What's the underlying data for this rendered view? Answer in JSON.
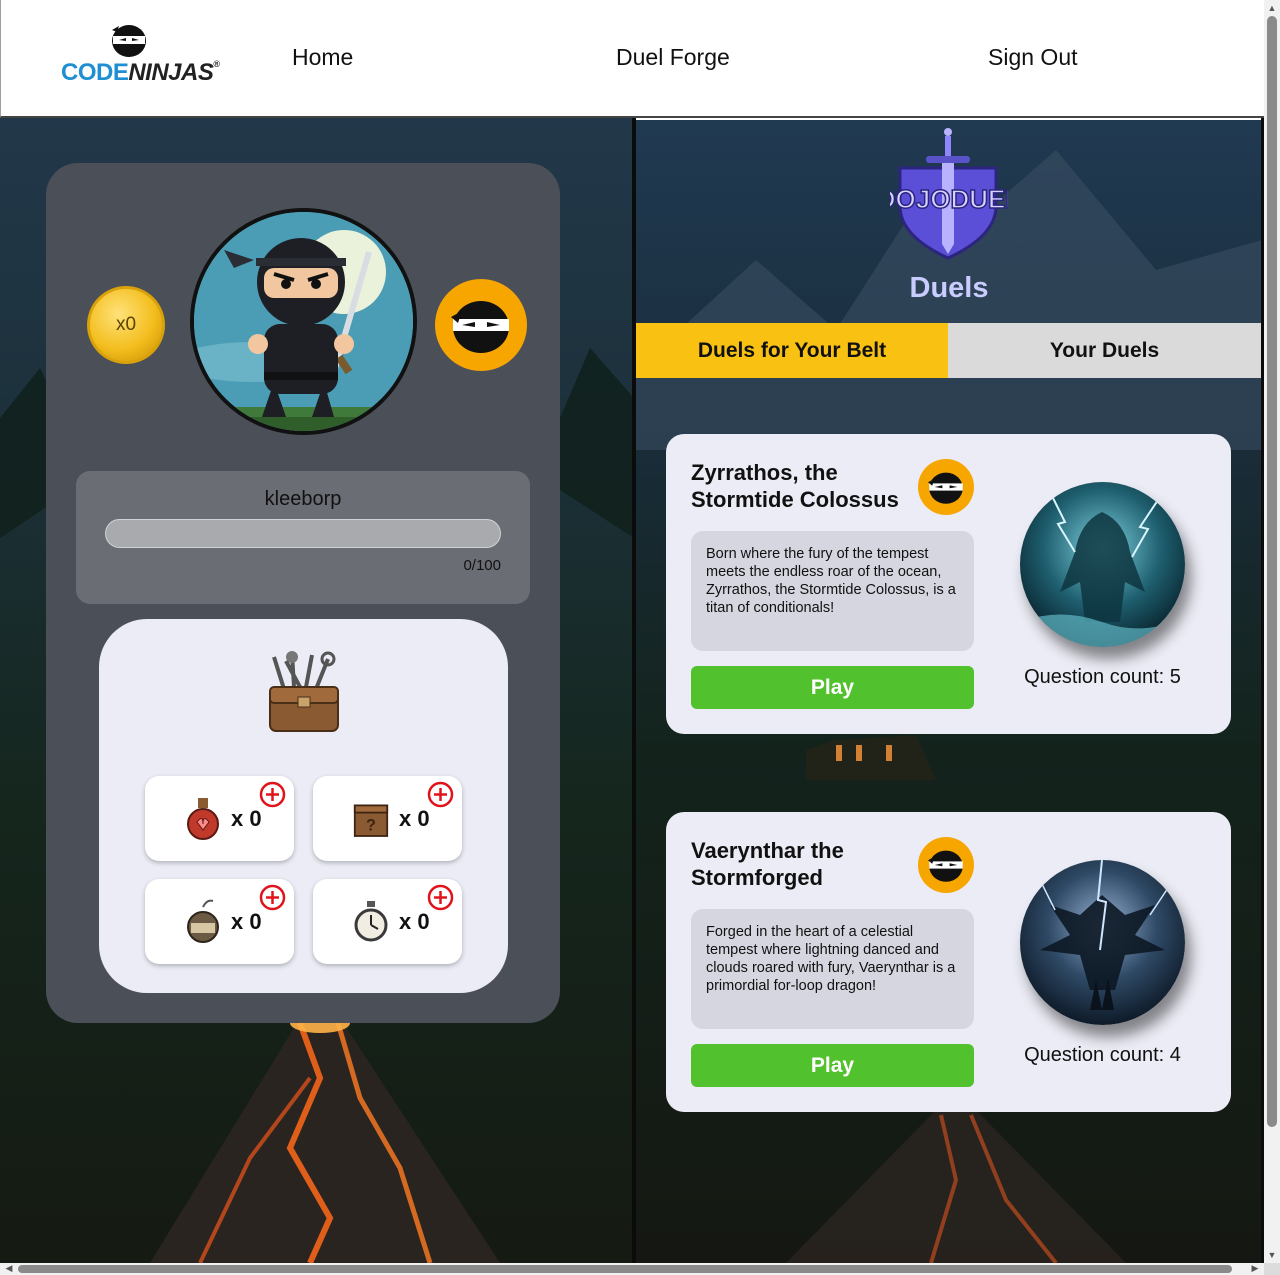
{
  "header": {
    "logo": {
      "part1": "CODE",
      "part2": "NINJAS",
      "reg": "®"
    },
    "nav": [
      {
        "label": "Home"
      },
      {
        "label": "Duel Forge"
      },
      {
        "label": "Sign Out"
      }
    ]
  },
  "profile": {
    "coins": "x0",
    "username": "kleeborp",
    "xp": {
      "current": 0,
      "max": 100,
      "label": "0/100"
    },
    "inventory": [
      {
        "icon": "health-potion-icon",
        "qty": "x 0"
      },
      {
        "icon": "mystery-box-icon",
        "qty": "x 0"
      },
      {
        "icon": "smoke-bomb-icon",
        "qty": "x 0",
        "icon_text": "SMOKE BOMB"
      },
      {
        "icon": "stopwatch-icon",
        "qty": "x 0"
      }
    ]
  },
  "dojo": {
    "logo_text": "DOJODUEL",
    "title": "Duels",
    "tabs": [
      {
        "label": "Duels for Your Belt",
        "active": true
      },
      {
        "label": "Your Duels",
        "active": false
      }
    ],
    "duels": [
      {
        "name": "Zyrrathos, the Stormtide Colossus",
        "description": "Born where the fury of the tempest meets the endless roar of the ocean, Zyrrathos, the Stormtide Colossus, is a titan of conditionals!",
        "play_label": "Play",
        "question_count": "Question count: 5"
      },
      {
        "name": "Vaerynthar the Stormforged",
        "description": "Forged in the heart of a celestial tempest where lightning danced and clouds roared with fury, Vaerynthar is a primordial for-loop dragon!",
        "play_label": "Play",
        "question_count": "Question count: 4"
      }
    ]
  },
  "colors": {
    "accent_yellow": "#f9c212",
    "belt_orange": "#f7a600",
    "play_green": "#52c12e",
    "title_lavender": "#c9ccff"
  }
}
